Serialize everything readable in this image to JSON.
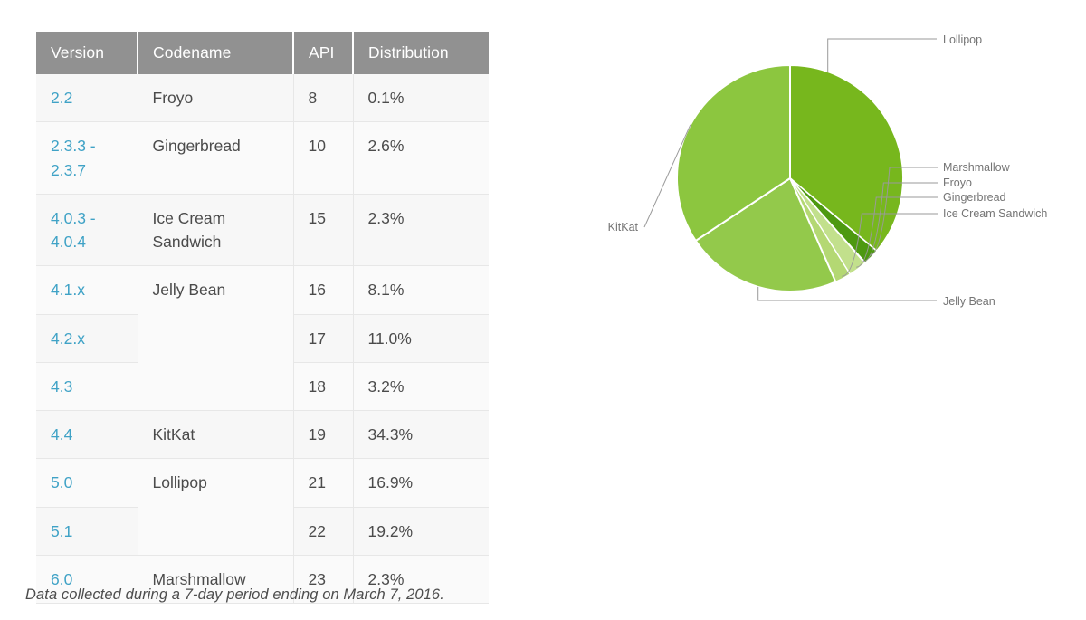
{
  "table": {
    "columns": [
      "Version",
      "Codename",
      "API",
      "Distribution"
    ],
    "rows": [
      {
        "version": "2.2",
        "codename": "Froyo",
        "api": "8",
        "distribution": "0.1%"
      },
      {
        "version": "2.3.3 - 2.3.7",
        "codename": "Gingerbread",
        "api": "10",
        "distribution": "2.6%"
      },
      {
        "version": "4.0.3 - 4.0.4",
        "codename": "Ice Cream Sandwich",
        "api": "15",
        "distribution": "2.3%"
      },
      {
        "version": "4.1.x",
        "codename": "Jelly Bean",
        "api": "16",
        "distribution": "8.1%"
      },
      {
        "version": "4.2.x",
        "codename": "",
        "api": "17",
        "distribution": "11.0%"
      },
      {
        "version": "4.3",
        "codename": "",
        "api": "18",
        "distribution": "3.2%"
      },
      {
        "version": "4.4",
        "codename": "KitKat",
        "api": "19",
        "distribution": "34.3%"
      },
      {
        "version": "5.0",
        "codename": "Lollipop",
        "api": "21",
        "distribution": "16.9%"
      },
      {
        "version": "5.1",
        "codename": "",
        "api": "22",
        "distribution": "19.2%"
      },
      {
        "version": "6.0",
        "codename": "Marshmallow",
        "api": "23",
        "distribution": "2.3%"
      }
    ],
    "version_lines": {
      "r0": [
        "2.2"
      ],
      "r1": [
        "2.3.3 -",
        "2.3.7"
      ],
      "r2": [
        "4.0.3 -",
        "4.0.4"
      ],
      "r3": [
        "4.1.x"
      ],
      "r4": [
        "4.2.x"
      ],
      "r5": [
        "4.3"
      ],
      "r6": [
        "4.4"
      ],
      "r7": [
        "5.0"
      ],
      "r8": [
        "5.1"
      ],
      "r9": [
        "6.0"
      ]
    },
    "codename_lines": {
      "ics": [
        "Ice Cream",
        "Sandwich"
      ]
    }
  },
  "note": "Data collected during a 7-day period ending on March 7, 2016.",
  "chart_data": {
    "type": "pie",
    "title": "",
    "unit": "%",
    "start_angle_deg": 0,
    "direction": "clockwise",
    "legend": "leader-labels",
    "labels": [
      "Lollipop",
      "Marshmallow",
      "Froyo",
      "Gingerbread",
      "Ice Cream Sandwich",
      "Jelly Bean",
      "KitKat"
    ],
    "values": [
      36.1,
      2.3,
      0.1,
      2.6,
      2.3,
      22.3,
      34.3
    ],
    "colors": [
      "#77b71d",
      "#4d9910",
      "#a7d15a",
      "#c2e08c",
      "#b4d873",
      "#93c94b",
      "#8cc63f"
    ],
    "slices": [
      {
        "label": "Lollipop",
        "value": 36.1,
        "color": "#77b71d",
        "note": "5.0 (16.9%) + 5.1 (19.2%)"
      },
      {
        "label": "Marshmallow",
        "value": 2.3,
        "color": "#4d9910"
      },
      {
        "label": "Froyo",
        "value": 0.1,
        "color": "#a7d15a"
      },
      {
        "label": "Gingerbread",
        "value": 2.6,
        "color": "#c2e08c"
      },
      {
        "label": "Ice Cream Sandwich",
        "value": 2.3,
        "color": "#b4d873"
      },
      {
        "label": "Jelly Bean",
        "value": 22.3,
        "color": "#93c94b",
        "note": "4.1.x + 4.2.x + 4.3"
      },
      {
        "label": "KitKat",
        "value": 34.3,
        "color": "#8cc63f"
      }
    ]
  },
  "pie_labels": {
    "lollipop": "Lollipop",
    "marshmallow": "Marshmallow",
    "froyo": "Froyo",
    "gingerbread": "Gingerbread",
    "ice_cream_sandwich": "Ice Cream Sandwich",
    "jelly_bean": "Jelly Bean",
    "kitkat": "KitKat"
  }
}
